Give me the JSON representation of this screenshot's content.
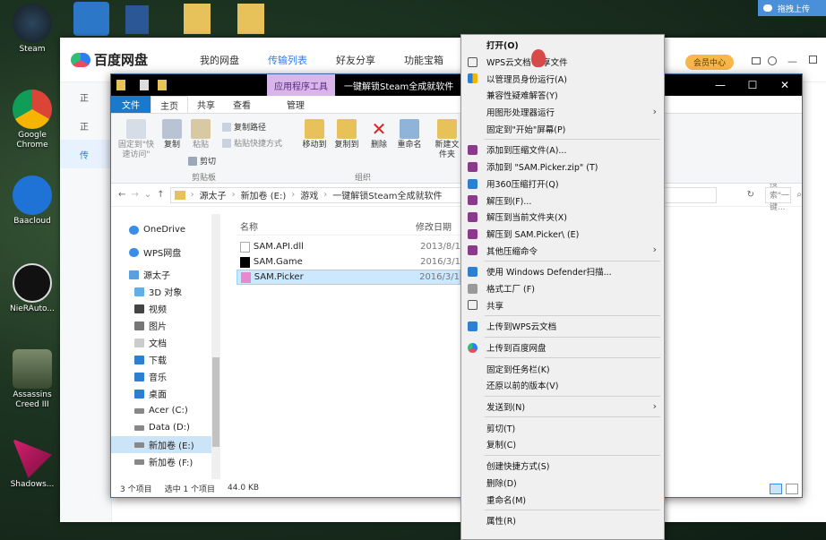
{
  "desktop": {
    "icons": [
      {
        "label": "Steam"
      },
      {
        "label": "Google Chrome"
      },
      {
        "label": "Baacloud"
      },
      {
        "label": "NieRAuto..."
      },
      {
        "label": "Assassins Creed III"
      },
      {
        "label": "Shadows..."
      }
    ],
    "corner_button": "拖拽上传"
  },
  "baidu": {
    "logo": "百度网盘",
    "nav": [
      "我的网盘",
      "传输列表",
      "好友分享",
      "功能宝箱"
    ],
    "vip": "会员中心",
    "side": [
      "正",
      "正",
      "传"
    ]
  },
  "explorer": {
    "context_tab": "应用程序工具",
    "title": "一键解锁Steam全成就软件",
    "tabs": {
      "file": "文件",
      "home": "主页",
      "share": "共享",
      "view": "查看",
      "manage": "管理"
    },
    "ribbon": {
      "pin": "固定到\"快速访问\"",
      "copy": "复制",
      "paste": "粘贴",
      "copy_path": "复制路径",
      "paste_shortcut": "粘贴快捷方式",
      "cut": "剪切",
      "clipboard": "剪贴板",
      "move_to": "移动到",
      "copy_to": "复制到",
      "delete": "删除",
      "rename": "重命名",
      "new_folder": "新建文件夹",
      "organize": "组织"
    },
    "address": [
      "源太子",
      "新加卷 (E:)",
      "游戏",
      "一键解锁Steam全成就软件"
    ],
    "search_placeholder": "搜索\"一键...",
    "nav_items": [
      "OneDrive",
      "WPS网盘",
      "源太子",
      "3D 对象",
      "视频",
      "图片",
      "文档",
      "下载",
      "音乐",
      "桌面",
      "Acer (C:)",
      "Data (D:)",
      "新加卷 (E:)",
      "新加卷 (F:)"
    ],
    "columns": {
      "name": "名称",
      "date": "修改日期"
    },
    "files": [
      {
        "name": "SAM.API.dll",
        "date": "2013/8/1"
      },
      {
        "name": "SAM.Game",
        "date": "2016/3/1"
      },
      {
        "name": "SAM.Picker",
        "date": "2016/3/1"
      }
    ],
    "status": {
      "count": "3 个项目",
      "selected": "选中 1 个项目",
      "size": "44.0 KB"
    }
  },
  "context_menu": {
    "items": [
      "打开(O)",
      "WPS云文档 分享文件",
      "以管理员身份运行(A)",
      "兼容性疑难解答(Y)",
      "用图形处理器运行",
      "固定到\"开始\"屏幕(P)",
      "添加到压缩文件(A)...",
      "添加到 \"SAM.Picker.zip\" (T)",
      "用360压缩打开(Q)",
      "解压到(F)...",
      "解压到当前文件夹(X)",
      "解压到 SAM.Picker\\ (E)",
      "其他压缩命令",
      "使用 Windows Defender扫描...",
      "格式工厂 (F)",
      "共享",
      "上传到WPS云文档",
      "上传到百度网盘",
      "固定到任务栏(K)",
      "还原以前的版本(V)",
      "发送到(N)",
      "剪切(T)",
      "复制(C)",
      "创建快捷方式(S)",
      "删除(D)",
      "重命名(M)",
      "属性(R)"
    ]
  }
}
